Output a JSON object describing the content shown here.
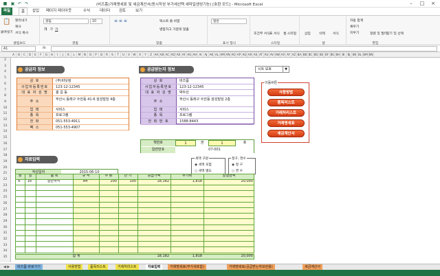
{
  "window": {
    "title": "(비즈폼)거래명세표 및 세금계산서(동시작성 부가세선택 세마일생성기능) [호환 모드] - Microsoft Excel"
  },
  "ribbon_tabs": [
    "파일",
    "홈",
    "삽입",
    "페이지 레이아웃",
    "수식",
    "데이터",
    "검토",
    "보기"
  ],
  "ribbon": {
    "paste": "붙여넣기",
    "cut": "잘라내기",
    "copy": "복사",
    "format_painter": "서식 복사",
    "clipboard": "클립보드",
    "font_name": "굴림",
    "font_size": "10",
    "font_group": "글꼴",
    "wrap_text": "텍스트 줄 바꿈",
    "merge_center": "병합하고 가운데 맞춤",
    "align_group": "맞춤",
    "number_format": "일반",
    "number_group": "표시 형식",
    "conditional": "조건부 서식",
    "as_table": "표 서식",
    "cell_styles": "셀 스타일",
    "style_group": "스타일",
    "insert": "삽입",
    "delete": "삭제",
    "format": "서식",
    "cells_group": "셀",
    "autosum": "자동 합계",
    "fill": "채우기",
    "clear": "지우기",
    "sort": "정렬 및 필터",
    "find": "찾기 및 선택",
    "edit_group": "편집"
  },
  "formula_bar": {
    "name_box": "A1",
    "fx": "fx"
  },
  "columns": [
    "A",
    "B",
    "C",
    "D",
    "E",
    "F",
    "G",
    "H",
    "I",
    "J",
    "K",
    "L",
    "M",
    "N",
    "O",
    "P",
    "Q",
    "R",
    "S",
    "T",
    "U",
    "V",
    "W",
    "X",
    "Y",
    "Z",
    "AA",
    "AB",
    "AC",
    "AD",
    "AE",
    "AF",
    "AG",
    "AH",
    "AI",
    "AJ",
    "AK",
    "AL",
    "AM",
    "AN",
    "AO",
    "AP",
    "AQ",
    "AR",
    "AS",
    "AT",
    "AU",
    "AV",
    "AW",
    "AX",
    "AY",
    "AZ",
    "BA",
    "BB",
    "BC",
    "BD",
    "BE",
    "BF",
    "BG",
    "BH",
    "BI",
    "BJ",
    "BK",
    "BL",
    "BM",
    "BN"
  ],
  "rows": [
    "2",
    "3",
    "4",
    "5",
    "6",
    "7",
    "8",
    "9",
    "10",
    "11",
    "12",
    "13",
    "14",
    "15",
    "16",
    "17",
    "18",
    "19",
    "20",
    "21",
    "22",
    "23",
    "24",
    "25",
    "26",
    "27",
    "28",
    "29",
    "30",
    "31",
    "32",
    "33",
    "34",
    "35"
  ],
  "supplier": {
    "header": "공급자 정보",
    "fields": [
      {
        "label": "상 호",
        "value": "(주)비닷컴"
      },
      {
        "label": "사업자등록번호",
        "value": "123-12-12345"
      },
      {
        "label": "대 표 자 성 명",
        "value": "홍 길 동"
      },
      {
        "label": "주 소",
        "value": "부산시 동래구 수안동 41-6 삼성빌딩 4층"
      },
      {
        "label": "업 태",
        "value": "서비스"
      },
      {
        "label": "종 목",
        "value": "프로그램"
      },
      {
        "label": "전 화",
        "value": "051-553-4911"
      },
      {
        "label": "팩 스",
        "value": "051-553-4907"
      }
    ]
  },
  "receiver": {
    "header": "공급받는자 정보",
    "fields": [
      {
        "label": "상 호",
        "value": "비즈폼"
      },
      {
        "label": "사업자등록번호",
        "value": "123-12-12345"
      },
      {
        "label": "대 표 자 성 명",
        "value": "박두산"
      },
      {
        "label": "주 소",
        "value": "부산시 동래구 수안동 삼성빌딩 2층"
      },
      {
        "label": "업 태",
        "value": "서비스"
      },
      {
        "label": "종 목",
        "value": "프로그램"
      },
      {
        "label": "전 화 번 호",
        "value": "1588-8443"
      }
    ],
    "book_no_label": "책번호",
    "book_no": "1",
    "vol_label": "권",
    "vol": "1",
    "ho_label": "호",
    "serial_label": "일련번호",
    "serial": "07-001"
  },
  "sheet_protect": "시트 보호",
  "nav": {
    "title": "이동버튼",
    "buttons": [
      "사용방법",
      "품목리스트",
      "거래처리스트",
      "거래명세표",
      "세금계산서"
    ]
  },
  "input": {
    "header": "자료입력",
    "tax_group": "세액 구분",
    "tax_options": [
      "세액 포함",
      "세액 별도"
    ],
    "claim_group": "청구, 영수",
    "claim_options": [
      "청 구",
      "영 수"
    ],
    "date_label": "작성일자",
    "date": "2015-06-10",
    "columns": [
      "월",
      "일",
      "품 목",
      "규 격",
      "수 량",
      "단 가",
      "공급가액",
      "부가세",
      "발행금액"
    ],
    "rows": [
      [
        "6",
        "16",
        "일반서식",
        "A4",
        "200",
        "100",
        "18,182",
        "1,818",
        "20,000"
      ]
    ],
    "total_label": "합 계",
    "total": [
      "18,182",
      "1,818",
      "20,000"
    ]
  },
  "sheet_tabs": [
    "비즈폼 바로가기",
    "사용방법",
    "품목리스트",
    "거래처리스트",
    "자료입력",
    "거래명세표(부가세포함)",
    "거래명세표(공급받는자보관용)",
    "세금계산서"
  ],
  "colors": {
    "accent": "#217346",
    "orange": "#e07a2e",
    "purple": "#7b4ea6",
    "green": "#5fa63a",
    "nav": "#d43c12"
  }
}
